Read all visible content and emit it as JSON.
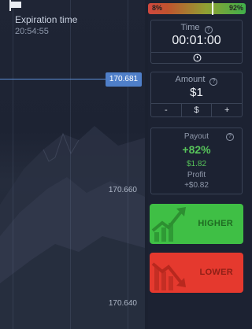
{
  "meter": {
    "left_label": "8%",
    "right_label": "92%",
    "marker_fraction": 0.65
  },
  "chart": {
    "expiration_label": "Expiration time",
    "expiration_value": "20:54:55",
    "current_price": "170.681",
    "axis_labels": [
      "170.660",
      "170.640"
    ]
  },
  "time": {
    "title": "Time",
    "value": "00:01:00"
  },
  "amount": {
    "title": "Amount",
    "value": "$1",
    "minus": "-",
    "currency": "$",
    "plus": "+"
  },
  "payout": {
    "title": "Payout",
    "percent": "+82%",
    "amount": "$1.82",
    "profit_label": "Profit",
    "profit_value": "+$0.82"
  },
  "buttons": {
    "higher": "HIGHER",
    "lower": "LOWER"
  },
  "colors": {
    "up": "#3fbf45",
    "down": "#e5392e",
    "accent": "#4f7fc9"
  },
  "icons": {
    "help": "?"
  }
}
